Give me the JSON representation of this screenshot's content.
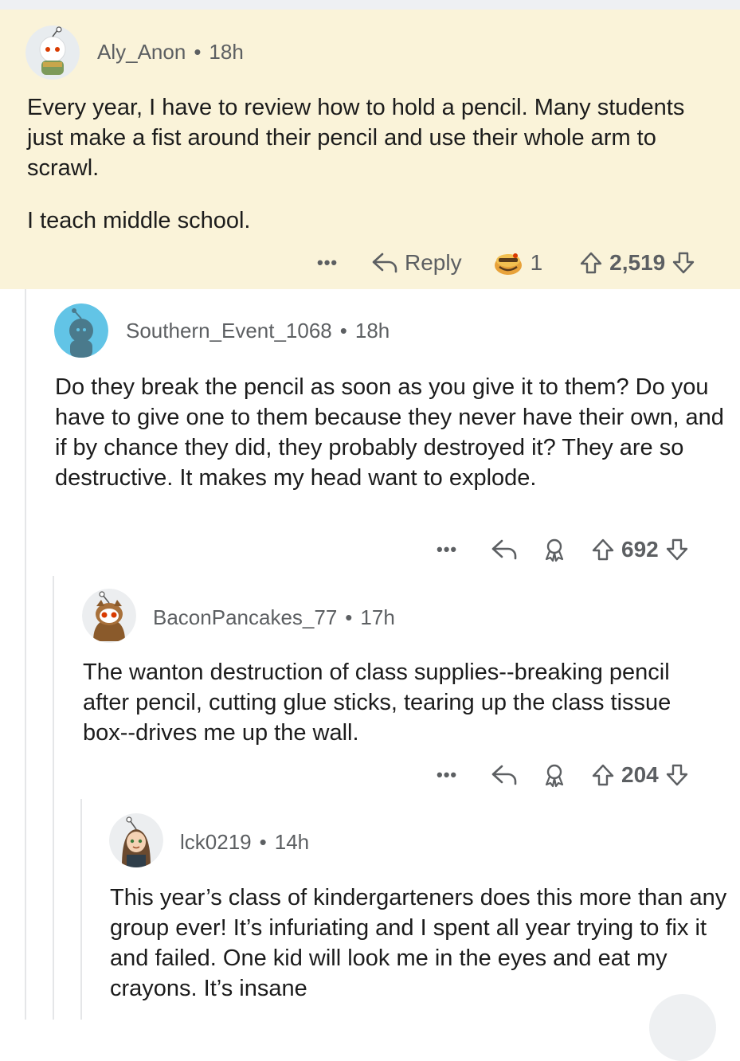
{
  "comments": [
    {
      "username": "Aly_Anon",
      "separator": "•",
      "age": "18h",
      "paragraphs": [
        "Every year, I have to review how to hold a pencil. Many students just make a fist around their pencil and use their whole arm to scrawl.",
        "I teach middle school."
      ],
      "more_label": "•••",
      "reply_label": "Reply",
      "award_count": "1",
      "score": "2,519"
    },
    {
      "username": "Southern_Event_1068",
      "separator": "•",
      "age": "18h",
      "paragraphs": [
        "Do they break the pencil as soon as you give it to them? Do you have to give one to them because they never have their own, and if by chance they did, they probably destroyed it? They are so destructive. It makes my head want to explode."
      ],
      "more_label": "•••",
      "score": "692"
    },
    {
      "username": "BaconPancakes_77",
      "separator": "•",
      "age": "17h",
      "paragraphs": [
        "The wanton destruction of class supplies--breaking pencil after pencil, cutting glue sticks, tearing up the class tissue box--drives me up the wall."
      ],
      "more_label": "•••",
      "score": "204"
    },
    {
      "username": "lck0219",
      "separator": "•",
      "age": "14h",
      "paragraphs": [
        "This year’s class of kindergarteners does this more than any group ever! It’s infuriating and I spent all year trying to fix it and failed. One kid will look me in the eyes and eat my crayons. It’s insane"
      ]
    }
  ],
  "colors": {
    "highlight_bg": "#faf3d9",
    "meta_text": "#5c5f62",
    "body_text": "#1c1c1c",
    "thread_line": "#e5e6e8"
  },
  "icons": [
    "more-icon",
    "reply-icon",
    "award-icon",
    "upvote-icon",
    "downvote-icon"
  ]
}
